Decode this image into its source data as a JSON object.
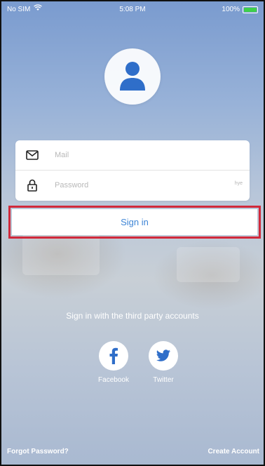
{
  "status_bar": {
    "carrier": "No SIM",
    "time": "5:08 PM",
    "battery": "100%"
  },
  "login": {
    "mail_placeholder": "Mail",
    "password_placeholder": "Password",
    "password_toggle": "hye",
    "signin_label": "Sign in"
  },
  "third_party": {
    "prompt": "Sign in with the third party accounts",
    "facebook_label": "Facebook",
    "twitter_label": "Twitter"
  },
  "footer": {
    "forgot_password": "Forgot Password?",
    "create_account": "Create Account"
  },
  "colors": {
    "accent": "#3f86d6",
    "highlight_border": "#d1293b",
    "battery": "#3fd04a",
    "icon_blue": "#2f6ec9"
  },
  "icons": [
    "wifi-icon",
    "battery-icon",
    "user-icon",
    "mail-icon",
    "lock-icon",
    "facebook-icon",
    "twitter-icon"
  ]
}
